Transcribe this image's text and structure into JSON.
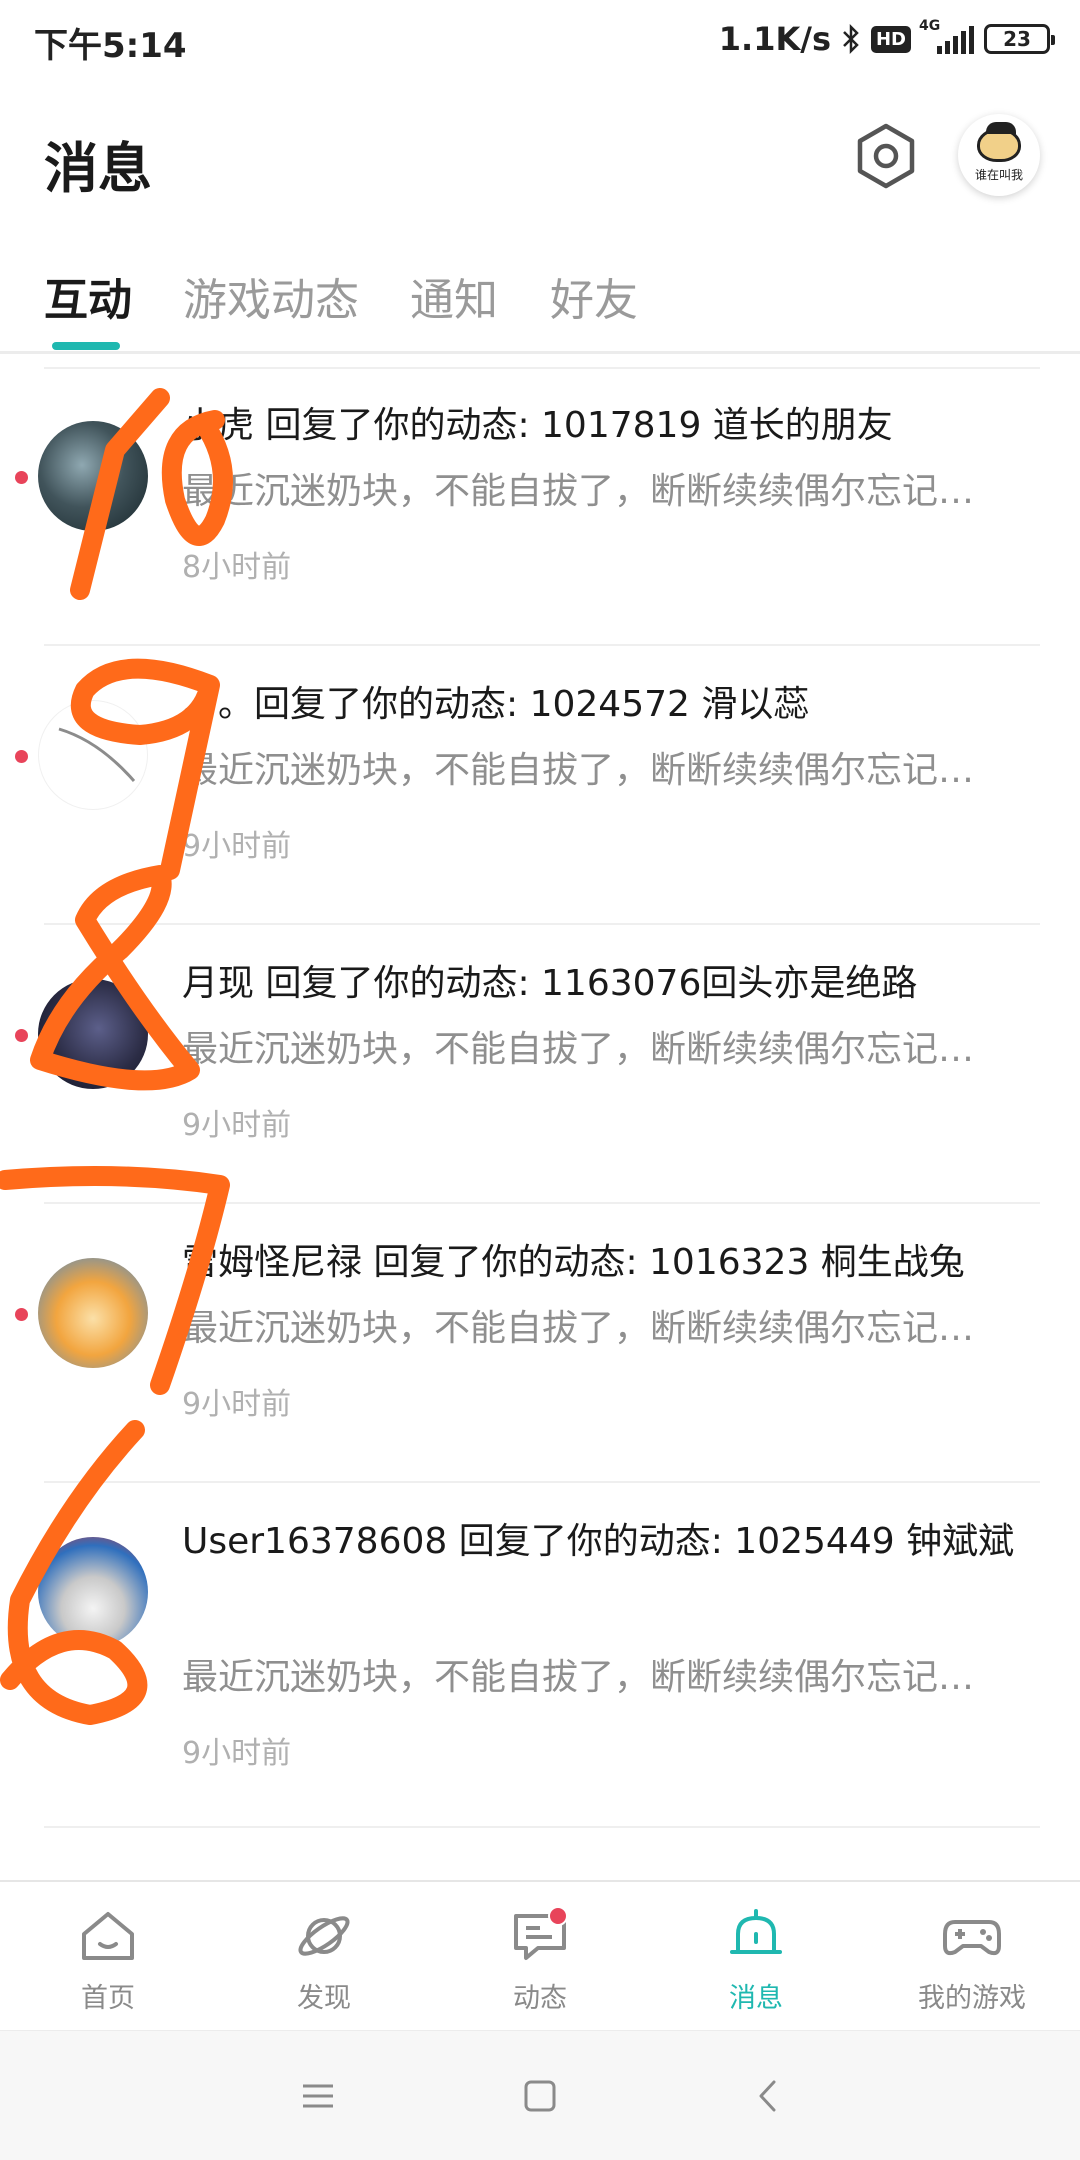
{
  "status_bar": {
    "time": "下午5:14",
    "net_speed": "1.1K/s",
    "hd": "HD",
    "network_type": "4G",
    "battery": "23"
  },
  "header": {
    "title": "消息",
    "avatar_caption": "谁在叫我"
  },
  "tabs": [
    {
      "label": "互动",
      "active": true
    },
    {
      "label": "游戏动态",
      "active": false
    },
    {
      "label": "通知",
      "active": false
    },
    {
      "label": "好友",
      "active": false
    }
  ],
  "messages": [
    {
      "title": "小虎 回复了你的动态: 1017819          道长的朋友",
      "preview": "最近沉迷奶块，不能自拔了，断断续续偶尔忘记…",
      "time": "8小时前",
      "unread": true
    },
    {
      "title": "。。。回复了你的动态: 1024572 滑以蕊",
      "preview": "最近沉迷奶块，不能自拔了，断断续续偶尔忘记…",
      "time": "9小时前",
      "unread": true
    },
    {
      "title": "月现 回复了你的动态: 1163076回头亦是绝路",
      "preview": "最近沉迷奶块，不能自拔了，断断续续偶尔忘记…",
      "time": "9小时前",
      "unread": true
    },
    {
      "title": "雷姆怪尼禄 回复了你的动态: 1016323  桐生战兔",
      "preview": "最近沉迷奶块，不能自拔了，断断续续偶尔忘记…",
      "time": "9小时前",
      "unread": true
    },
    {
      "title": "User16378608 回复了你的动态: 1025449   钟斌斌",
      "preview": "最近沉迷奶块，不能自拔了，断断续续偶尔忘记…",
      "time": "9小时前",
      "unread": true
    }
  ],
  "annotations": [
    "10",
    "9",
    "8",
    "7",
    "6"
  ],
  "bottom_nav": [
    {
      "label": "首页",
      "icon": "home-icon",
      "active": false
    },
    {
      "label": "发现",
      "icon": "planet-icon",
      "active": false
    },
    {
      "label": "动态",
      "icon": "chat-icon",
      "active": false,
      "badge": true
    },
    {
      "label": "消息",
      "icon": "bell-icon",
      "active": true
    },
    {
      "label": "我的游戏",
      "icon": "gamepad-icon",
      "active": false
    }
  ],
  "colors": {
    "accent": "#1fb8b0",
    "unread": "#e8445a",
    "scribble": "#ff6a1a"
  }
}
